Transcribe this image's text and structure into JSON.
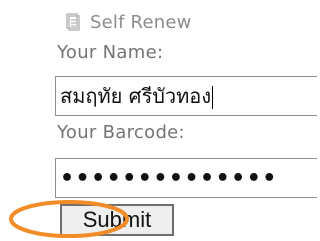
{
  "form": {
    "title": "Self Renew",
    "icons": {
      "title_icon": "book-icon"
    },
    "labels": {
      "name": "Your Name:",
      "barcode": "Your Barcode:"
    },
    "inputs": {
      "name_value": "สมฤทัย ศรีบัวทอง",
      "barcode_value": "••••••••••••••"
    },
    "buttons": {
      "submit": "Submit"
    },
    "annotation": {
      "highlight_color": "#F28C28"
    }
  }
}
